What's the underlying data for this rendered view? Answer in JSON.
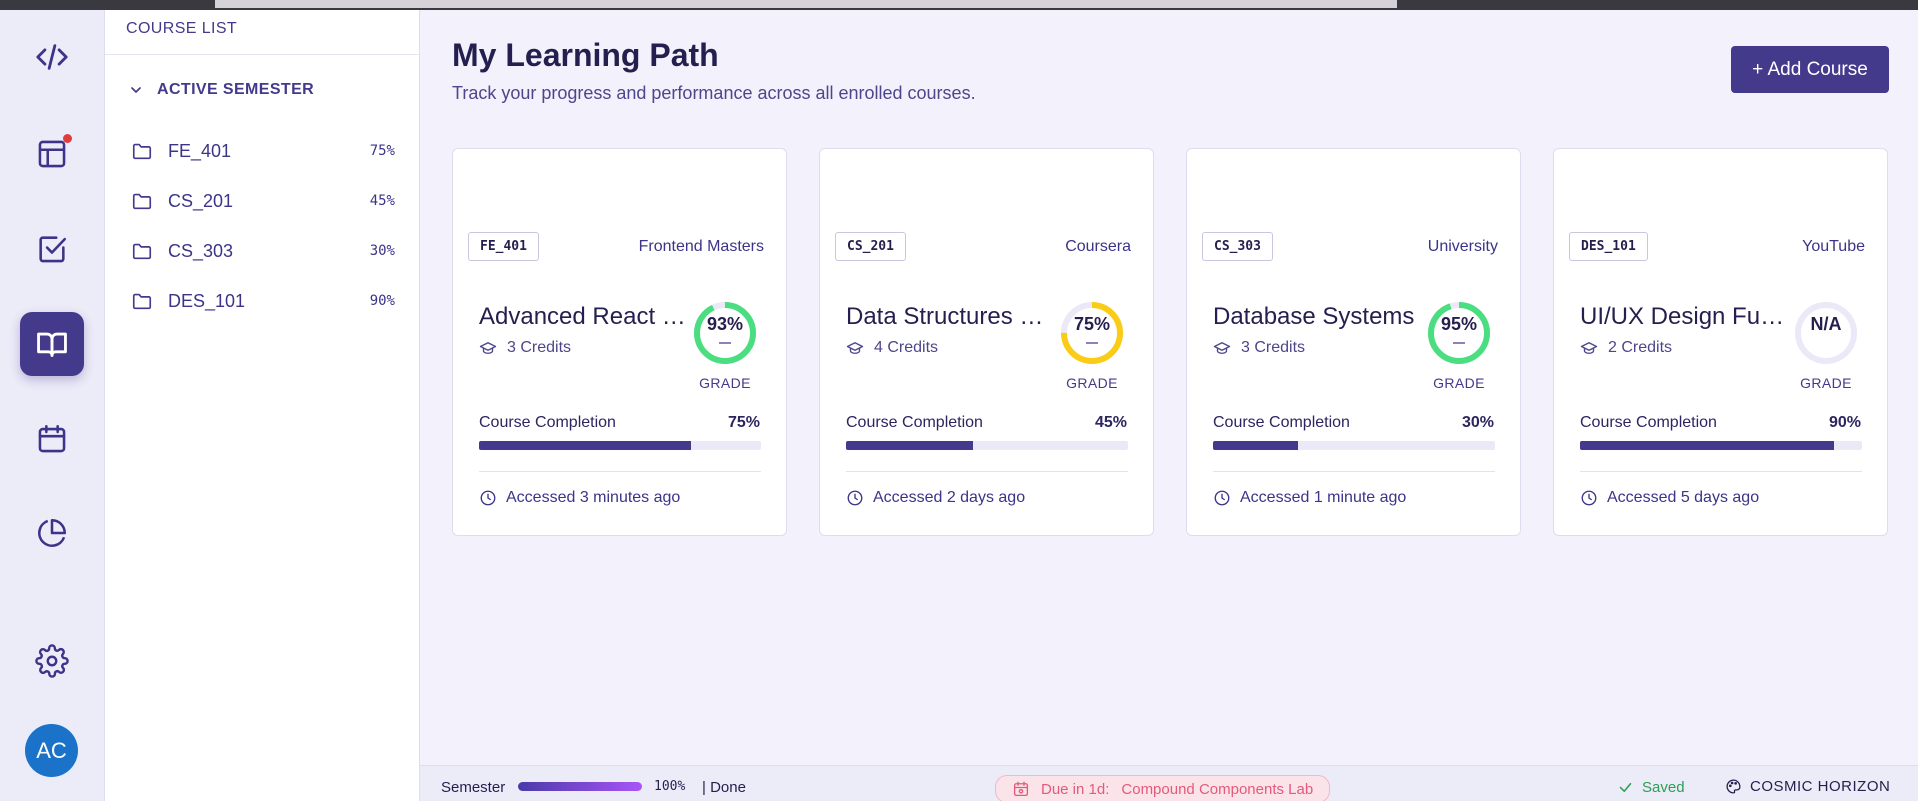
{
  "sidebar": {
    "logo_icon": "code-icon",
    "nav": [
      {
        "name": "dashboard",
        "icon": "layout-icon",
        "has_notification": true,
        "active": false
      },
      {
        "name": "tasks",
        "icon": "checkbox-icon",
        "has_notification": false,
        "active": false
      },
      {
        "name": "courses",
        "icon": "book-icon",
        "has_notification": false,
        "active": true
      },
      {
        "name": "calendar",
        "icon": "calendar-icon",
        "has_notification": false,
        "active": false
      },
      {
        "name": "analytics",
        "icon": "pie-chart-icon",
        "has_notification": false,
        "active": false
      }
    ],
    "settings_icon": "gear-icon",
    "avatar_initials": "AC"
  },
  "course_list": {
    "title": "COURSE LIST",
    "group_title": "ACTIVE SEMESTER",
    "items": [
      {
        "code": "FE_401",
        "percent": "75%"
      },
      {
        "code": "CS_201",
        "percent": "45%"
      },
      {
        "code": "CS_303",
        "percent": "30%"
      },
      {
        "code": "DES_101",
        "percent": "90%"
      }
    ]
  },
  "header": {
    "title": "My Learning Path",
    "subtitle": "Track your progress and performance across all enrolled courses.",
    "add_button": "+ Add Course"
  },
  "cards": [
    {
      "code": "FE_401",
      "provider": "Frontend Masters",
      "title": "Advanced React Patterns",
      "credits": "3 Credits",
      "grade": "93%",
      "grade_value": 0.93,
      "grade_color": "#4ade80",
      "grade_label": "GRADE",
      "completion_label": "Course Completion",
      "completion_pct": "75%",
      "completion": 0.75,
      "accessed": "Accessed 3 minutes ago"
    },
    {
      "code": "CS_201",
      "provider": "Coursera",
      "title": "Data Structures & Algorithms",
      "credits": "4 Credits",
      "grade": "75%",
      "grade_value": 0.75,
      "grade_color": "#facc15",
      "grade_label": "GRADE",
      "completion_label": "Course Completion",
      "completion_pct": "45%",
      "completion": 0.45,
      "accessed": "Accessed 2 days ago"
    },
    {
      "code": "CS_303",
      "provider": "University",
      "title": "Database Systems",
      "credits": "3 Credits",
      "grade": "95%",
      "grade_value": 0.95,
      "grade_color": "#4ade80",
      "grade_label": "GRADE",
      "completion_label": "Course Completion",
      "completion_pct": "30%",
      "completion": 0.3,
      "accessed": "Accessed 1 minute ago"
    },
    {
      "code": "DES_101",
      "provider": "YouTube",
      "title": "UI/UX Design Fundamentals",
      "credits": "2 Credits",
      "grade": "N/A",
      "grade_value": 0,
      "grade_color": "#e8e6f5",
      "grade_label": "GRADE",
      "completion_label": "Course Completion",
      "completion_pct": "90%",
      "completion": 0.9,
      "accessed": "Accessed 5 days ago"
    }
  ],
  "status_bar": {
    "semester_label": "Semester",
    "semester_pct": "100%",
    "semester_progress": 1.0,
    "done_label": "| Done",
    "due_prefix": "Due in 1d:",
    "due_task": "Compound Components Lab",
    "saved_label": "Saved",
    "theme_label": "COSMIC HORIZON"
  }
}
